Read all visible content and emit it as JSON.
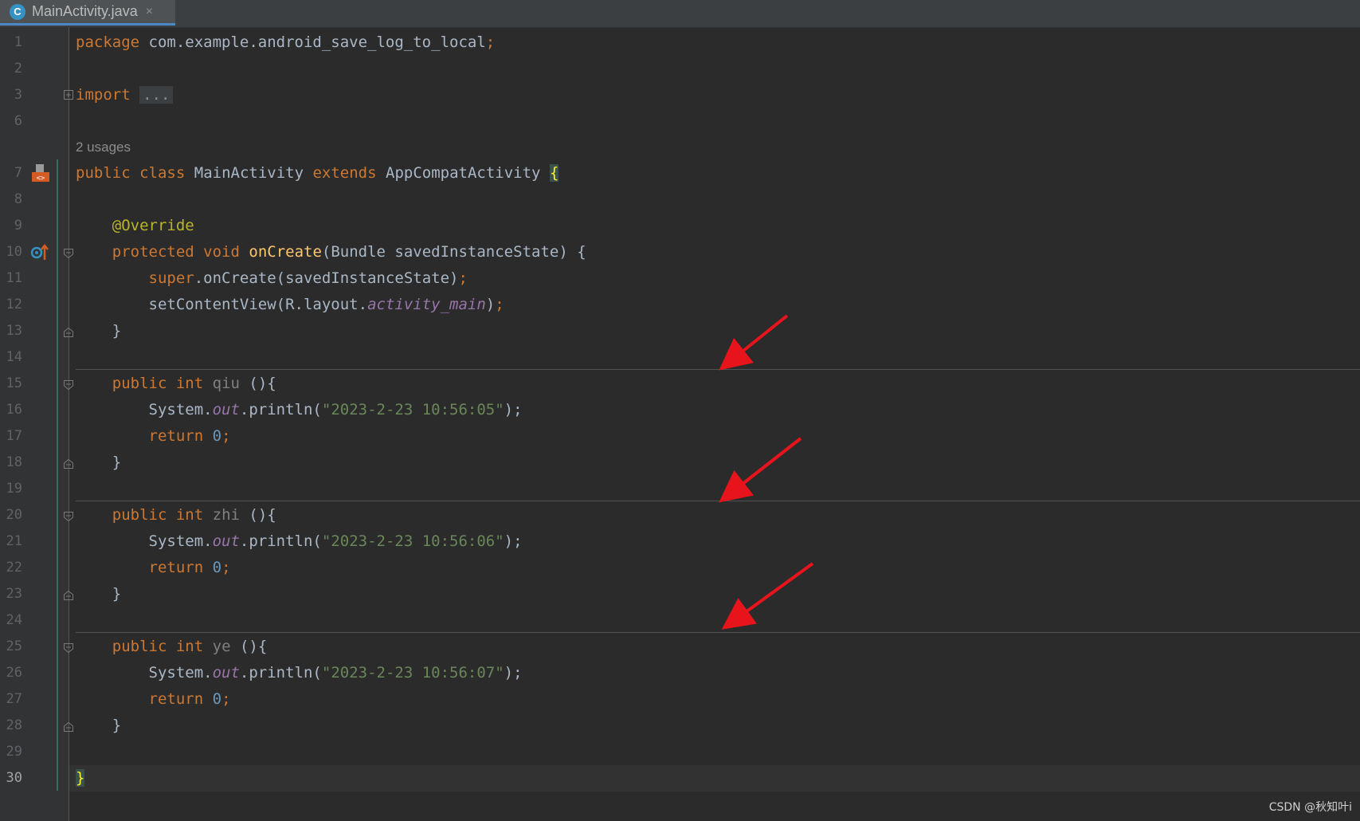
{
  "tab": {
    "icon_letter": "C",
    "title": "MainActivity.java",
    "close": "×"
  },
  "usages_hint": "2 usages",
  "lines": [
    {
      "n": "1"
    },
    {
      "n": "2"
    },
    {
      "n": "3"
    },
    {
      "n": "6"
    },
    {
      "n": "7"
    },
    {
      "n": "8"
    },
    {
      "n": "9"
    },
    {
      "n": "10"
    },
    {
      "n": "11"
    },
    {
      "n": "12"
    },
    {
      "n": "13"
    },
    {
      "n": "14"
    },
    {
      "n": "15"
    },
    {
      "n": "16"
    },
    {
      "n": "17"
    },
    {
      "n": "18"
    },
    {
      "n": "19"
    },
    {
      "n": "20"
    },
    {
      "n": "21"
    },
    {
      "n": "22"
    },
    {
      "n": "23"
    },
    {
      "n": "24"
    },
    {
      "n": "25"
    },
    {
      "n": "26"
    },
    {
      "n": "27"
    },
    {
      "n": "28"
    },
    {
      "n": "29"
    },
    {
      "n": "30"
    }
  ],
  "code": {
    "package_kw": "package",
    "package_name": " com.example.android_save_log_to_local",
    "semicolon": ";",
    "import_kw": "import",
    "import_fold": "...",
    "public": "public",
    "class": "class",
    "class_name": "MainActivity",
    "extends": "extends",
    "super_class": "AppCompatActivity",
    "open_brace": "{",
    "override": "@Override",
    "protected": "protected",
    "void": "void",
    "onCreate": "onCreate",
    "onCreate_params": "(Bundle savedInstanceState) {",
    "super": "super",
    "super_call": ".onCreate(savedInstanceState)",
    "setContentView": "setContentView(R.layout.",
    "activity_main": "activity_main",
    "close_paren": ")",
    "close_brace": "}",
    "int": "int",
    "m1_name": "qiu",
    "m2_name": "zhi",
    "m3_name": "ye",
    "m_sig": " (){",
    "system": "System.",
    "out": "out",
    "println": ".println(",
    "str1": "\"2023-2-23 10:56:05\"",
    "str2": "\"2023-2-23 10:56:06\"",
    "str3": "\"2023-2-23 10:56:07\"",
    "ret_close": ");",
    "return": "return",
    "zero": "0",
    "final_brace": "}"
  },
  "watermark": "CSDN @秋知叶i",
  "colors": {
    "background": "#2b2b2b",
    "keyword": "#cc7832",
    "string": "#6a8759",
    "arrow": "#e8141c"
  }
}
